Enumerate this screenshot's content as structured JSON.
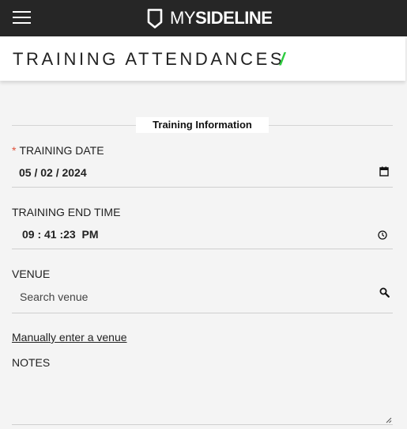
{
  "topbar": {
    "menu_icon": "hamburger-icon",
    "logo_icon": "shield-icon",
    "logo_my": "MY",
    "logo_sideline": "SIDELINE"
  },
  "page": {
    "title": "TRAINING ATTENDANCES",
    "title_slash": "/",
    "accent_color": "#2ecc40"
  },
  "form": {
    "section_title": "Training Information",
    "training_date": {
      "required_marker": "*",
      "label": "TRAINING DATE",
      "value": "05 / 02 / 2024",
      "icon": "calendar-icon"
    },
    "training_end_time": {
      "label": "TRAINING END TIME",
      "value": "09 : 41 :23  PM",
      "icon": "clock-icon"
    },
    "venue": {
      "label": "VENUE",
      "placeholder": "Search venue",
      "icon": "search-icon"
    },
    "manual_venue_link": "Manually enter a venue",
    "notes": {
      "label": "NOTES",
      "value": ""
    }
  }
}
